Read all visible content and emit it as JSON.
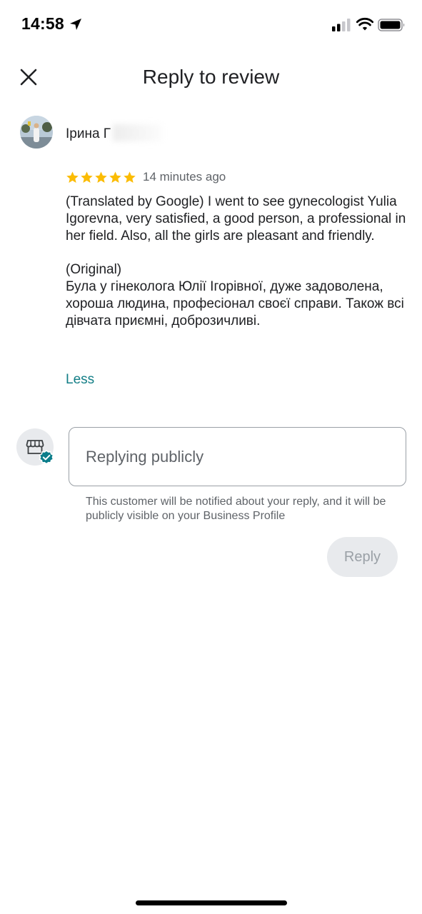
{
  "status_bar": {
    "time": "14:58",
    "icons": [
      "location-arrow-icon",
      "cellular-signal-icon",
      "wifi-icon",
      "battery-icon"
    ]
  },
  "header": {
    "title": "Reply to review",
    "close_icon": "close-icon"
  },
  "review": {
    "reviewer_name": "Ірина Г",
    "rating": 5,
    "rating_max": 5,
    "star_color": "#fbbc04",
    "time_ago": "14 minutes ago",
    "text": "(Translated by Google) I went to see gynecologist Yulia Igorevna, very satisfied, a good person, a professional in her field. Also, all the girls are pleasant and friendly.\n\n(Original)\nБула у гінеколога Юлії Ігорівної, дуже задоволена, хороша людина, професіонал своєї справи. Також всі дівчата приємні, доброзичливі.",
    "less_label": "Less"
  },
  "reply": {
    "business_icon": "storefront-icon",
    "verified_icon": "verified-badge-icon",
    "placeholder": "Replying publicly",
    "value": "",
    "notice": "This customer will be notified about your reply, and it will be publicly visible on your Business Profile",
    "button_label": "Reply",
    "button_enabled": false
  },
  "colors": {
    "accent_teal": "#137e86",
    "verified_teal": "#0b7d8a",
    "text_primary": "#202124",
    "text_secondary": "#5f6368",
    "button_disabled_bg": "#e8eaed",
    "button_disabled_text": "#9aa0a6"
  }
}
